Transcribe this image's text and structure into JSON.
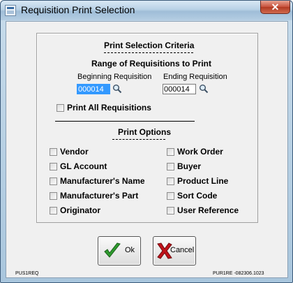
{
  "window": {
    "title": "Requisition Print Selection",
    "close_glyph": "✕"
  },
  "criteria": {
    "heading": "Print Selection Criteria",
    "range_heading": "Range of Requisitions to Print",
    "beginning_label": "Beginning Requisition",
    "beginning_value": "000014",
    "ending_label": "Ending Requisition",
    "ending_value": "000014",
    "print_all_label": "Print All Requisitions"
  },
  "options": {
    "heading": "Print Options",
    "left": [
      "Vendor",
      "GL Account",
      "Manufacturer's Name",
      "Manufacturer's Part",
      "Originator"
    ],
    "right": [
      "Work Order",
      "Buyer",
      "Product Line",
      "Sort Code",
      "User Reference"
    ]
  },
  "buttons": {
    "ok": "Ok",
    "cancel": "Cancel"
  },
  "footer": {
    "left": "PUS1REQ",
    "right": "PUR1RE -082306.1023"
  },
  "colors": {
    "selection": "#3399ff",
    "ok_icon": "#2e9b2e",
    "cancel_icon": "#c0121a"
  }
}
